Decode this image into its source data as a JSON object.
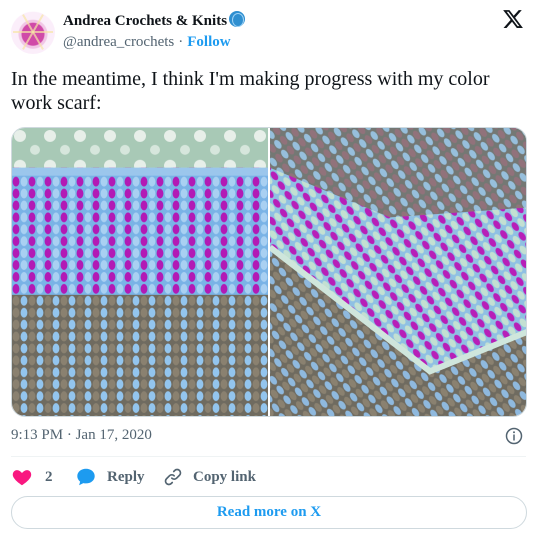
{
  "author": {
    "name": "Andrea Crochets & Knits",
    "handle": "@andrea_crochets",
    "follow_label": "Follow",
    "separator": "·"
  },
  "tweet": {
    "text": "In the meantime, I think I'm making progress with my color work scarf:",
    "timestamp": "9:13 PM · Jan 17, 2020"
  },
  "actions": {
    "like_count": "2",
    "reply_label": "Reply",
    "copy_label": "Copy link"
  },
  "footer": {
    "read_more_label": "Read more on X"
  },
  "icons": {
    "platform_logo": "x-logo-icon",
    "info": "info-icon",
    "like": "heart-icon",
    "reply": "speech-bubble-icon",
    "copy": "link-icon",
    "name_emoji": "yarn-ball-icon"
  },
  "colors": {
    "accent": "#1d9bf0",
    "like": "#f91880",
    "text": "#0f1419",
    "secondary": "#536471",
    "border": "#cfd9de"
  }
}
